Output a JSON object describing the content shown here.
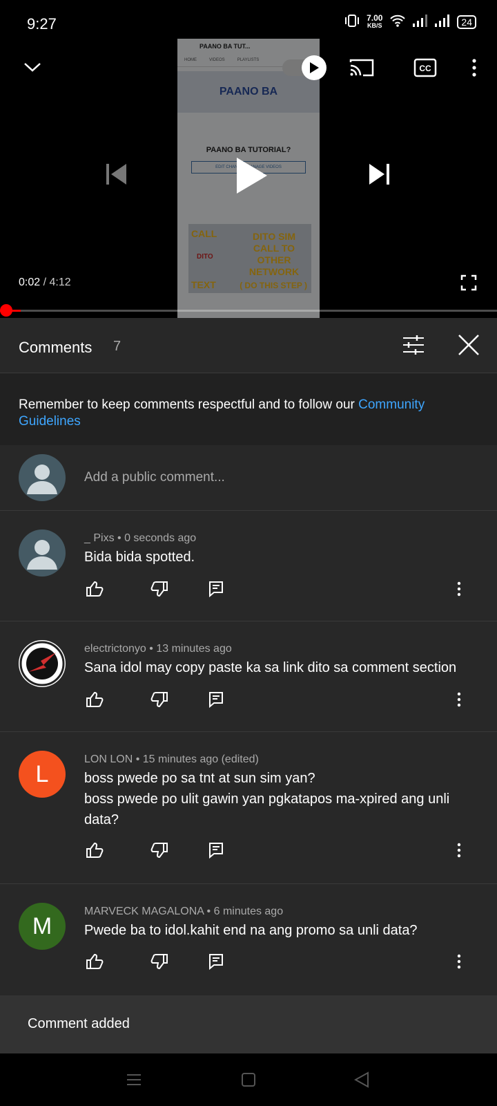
{
  "status_bar": {
    "time": "9:27",
    "net_speed_value": "7.00",
    "net_speed_unit": "KB/S",
    "battery": "24"
  },
  "video": {
    "current_time": "0:02",
    "separator": " / ",
    "duration": "4:12",
    "progress_fraction": 0.008,
    "thumbnail": {
      "top_title": "PAANO BA TUT...",
      "tabs": [
        "HOME",
        "VIDEOS",
        "PLAYLISTS"
      ],
      "banner_text": "PAANO BA",
      "channel_name": "PAANO BA TUTORIAL?",
      "edit_button": "EDIT CHANNEL   MANAGE VIDEOS",
      "promo_call": "CALL",
      "promo_dito": "DITO",
      "promo_text": "TEXT",
      "promo_big": "DITO SIM CALL TO OTHER NETWORK",
      "promo_step": "( DO THIS STEP )"
    }
  },
  "comments_panel": {
    "title": "Comments",
    "count": "7",
    "notice_text": "Remember to keep comments respectful and to follow our ",
    "notice_link": "Community Guidelines",
    "add_placeholder": "Add a public comment...",
    "comments": [
      {
        "author": "_ Pixs",
        "time": "0 seconds ago",
        "text": "Bida bida spotted.",
        "avatar": "default"
      },
      {
        "author": "electrictonyo",
        "time": "13 minutes ago",
        "text": "Sana idol may copy paste ka sa link dito sa comment section",
        "avatar": "logo"
      },
      {
        "author": "LON LON",
        "time": "15 minutes ago (edited)",
        "text": "boss pwede po sa tnt at sun sim yan?\nboss pwede po ulit gawin yan pgkatapos ma-xpired ang unli data?",
        "avatar_letter": "L",
        "avatar_color": "#f4511e"
      },
      {
        "author": "MARVECK MAGALONA",
        "time": "6 minutes ago",
        "text": "Pwede ba to idol.kahit end na ang promo sa unli data?",
        "avatar_letter": "M",
        "avatar_color": "#33691e"
      }
    ]
  },
  "snackbar": {
    "message": "Comment added"
  },
  "colors": {
    "accent_red": "#ff0000",
    "link_blue": "#3ea6ff",
    "panel_bg": "#282828"
  }
}
